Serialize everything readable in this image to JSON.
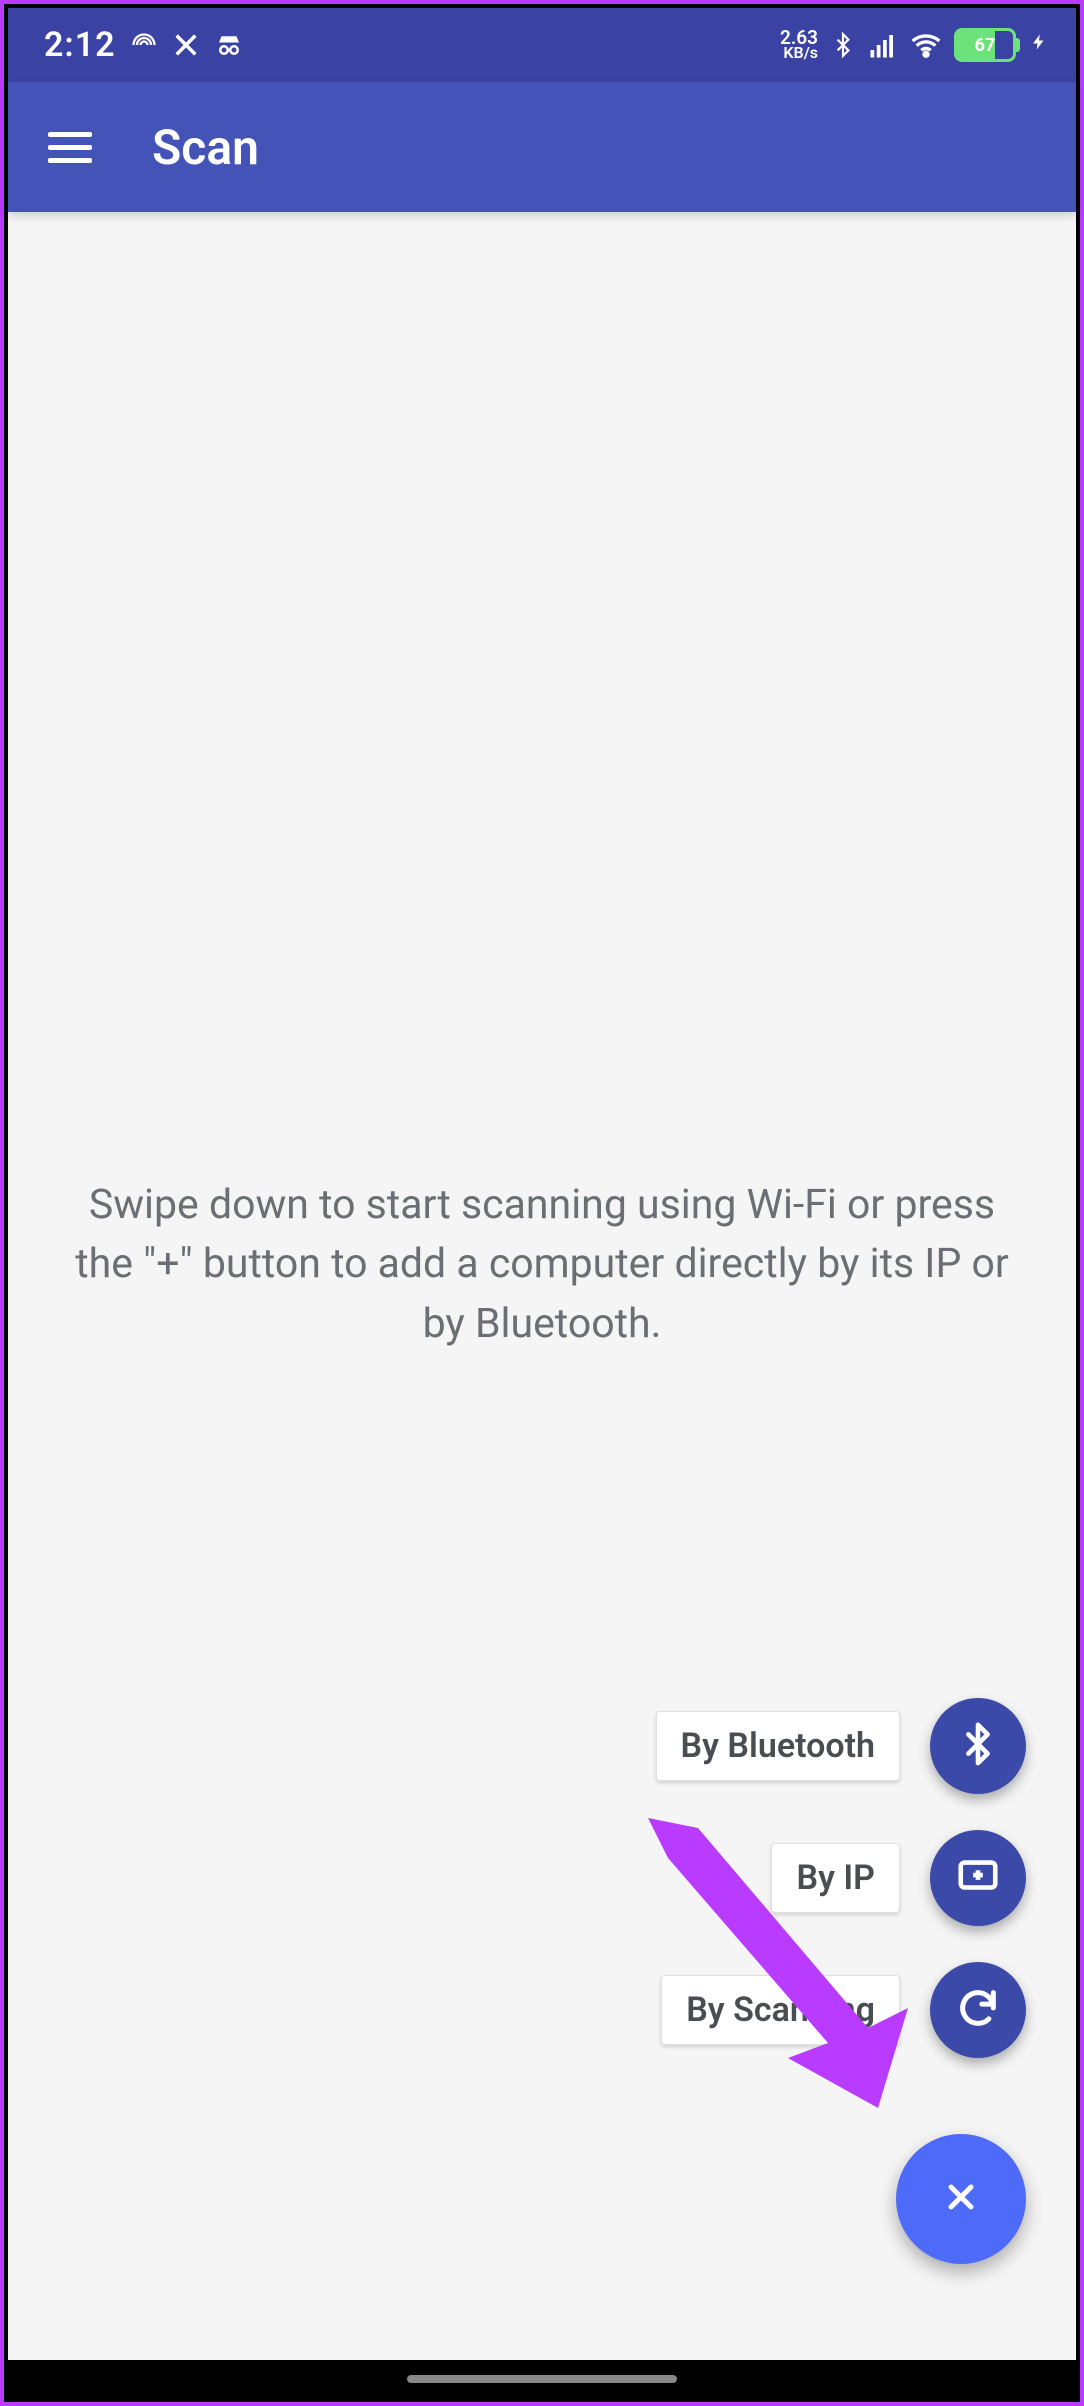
{
  "status_bar": {
    "time": "2:12",
    "net_speed_value": "2.63",
    "net_speed_unit": "KB/s",
    "battery_percent": "67"
  },
  "app_bar": {
    "title": "Scan"
  },
  "content": {
    "hint": "Swipe down to start scanning using Wi-Fi or press the \"+\" button to add a computer directly by its IP or by Bluetooth."
  },
  "fab": {
    "items": [
      {
        "label": "By Bluetooth",
        "icon": "bluetooth-icon",
        "name": "add-by-bluetooth"
      },
      {
        "label": "By IP",
        "icon": "monitor-add-icon",
        "name": "add-by-ip"
      },
      {
        "label": "By Scanning",
        "icon": "refresh-icon",
        "name": "add-by-scanning"
      }
    ],
    "main_icon": "close-icon"
  },
  "annotation": {
    "description": "Purple arrow pointing from the 'By Bluetooth' chip toward the 'By Scanning' refresh button"
  }
}
